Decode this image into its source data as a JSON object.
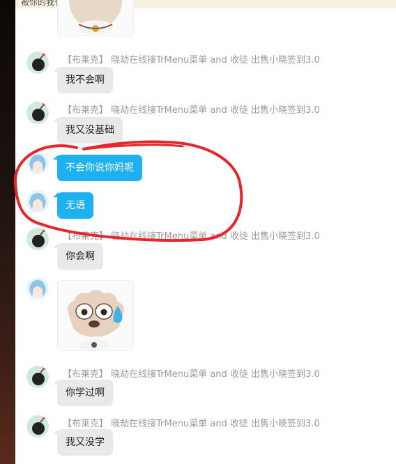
{
  "top_banner_text": "被你的我也很放出来",
  "sender_name": "【布莱克】 晓劫在线接TrMenu菜单 and 收徒 出售小晓签到3.0",
  "messages": [
    {
      "type": "sticker",
      "from": "other"
    },
    {
      "type": "text",
      "from": "other",
      "show_name": true,
      "text": "我不会啊"
    },
    {
      "type": "text",
      "from": "other",
      "show_name": true,
      "text": "我又没基础"
    },
    {
      "type": "text",
      "from": "self",
      "show_name": false,
      "text": "不会你说你妈呢"
    },
    {
      "type": "text",
      "from": "self",
      "show_name": false,
      "text": "无语"
    },
    {
      "type": "text",
      "from": "other",
      "show_name": true,
      "text": "你会啊"
    },
    {
      "type": "sticker",
      "from": "self"
    },
    {
      "type": "text",
      "from": "other",
      "show_name": true,
      "text": "你学过啊"
    },
    {
      "type": "text",
      "from": "other",
      "show_name": true,
      "text": "我又没学"
    }
  ],
  "colors": {
    "self_bubble": "#1eb1f2",
    "other_bubble": "#e9e9e9",
    "annotation": "#e8262a"
  }
}
